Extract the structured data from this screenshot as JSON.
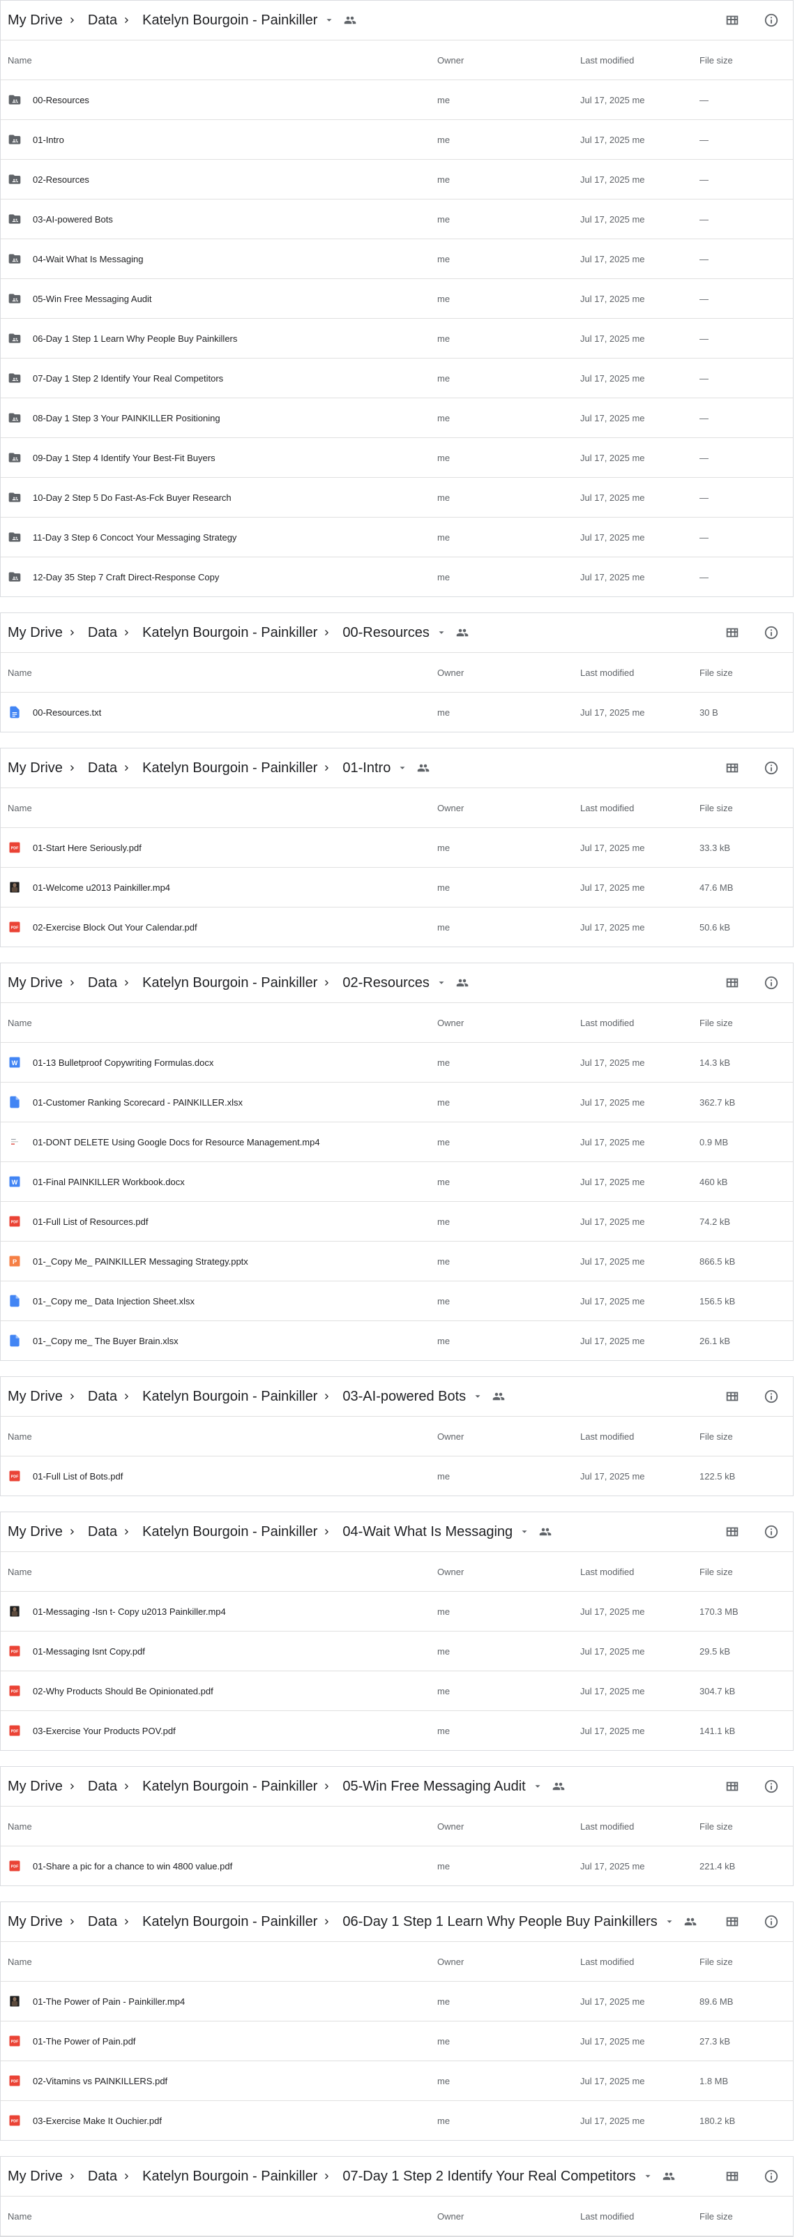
{
  "columns": {
    "name": "Name",
    "owner": "Owner",
    "modified": "Last modified",
    "size": "File size"
  },
  "icons": {
    "chevron": "chevron-right-icon",
    "dropdown": "arrow-drop-down-icon",
    "shared": "people-icon",
    "grid": "grid-view-icon",
    "info": "info-icon",
    "folder": "shared-folder-icon",
    "pdf": "pdf-icon",
    "video": "video-thumbnail-icon",
    "doc": "word-doc-icon",
    "sheet": "blue-file-icon",
    "ppt": "powerpoint-icon",
    "txt": "text-file-icon"
  },
  "colors": {
    "folder": "#5f6368",
    "pdf": "#ea4335",
    "doc": "#4285f4",
    "ppt": "#f57f45",
    "txt": "#4285f4"
  },
  "sections": [
    {
      "crumbs": [
        "My Drive",
        "Data",
        "Katelyn Bourgoin - Painkiller"
      ],
      "rows": [
        {
          "type": "folder",
          "name": "00-Resources",
          "owner": "me",
          "modified": "Jul 17, 2025 me",
          "size": "—"
        },
        {
          "type": "folder",
          "name": "01-Intro",
          "owner": "me",
          "modified": "Jul 17, 2025 me",
          "size": "—"
        },
        {
          "type": "folder",
          "name": "02-Resources",
          "owner": "me",
          "modified": "Jul 17, 2025 me",
          "size": "—"
        },
        {
          "type": "folder",
          "name": "03-AI-powered Bots",
          "owner": "me",
          "modified": "Jul 17, 2025 me",
          "size": "—"
        },
        {
          "type": "folder",
          "name": "04-Wait What Is Messaging",
          "owner": "me",
          "modified": "Jul 17, 2025 me",
          "size": "—"
        },
        {
          "type": "folder",
          "name": "05-Win Free Messaging Audit",
          "owner": "me",
          "modified": "Jul 17, 2025 me",
          "size": "—"
        },
        {
          "type": "folder",
          "name": "06-Day 1 Step 1 Learn Why People Buy Painkillers",
          "owner": "me",
          "modified": "Jul 17, 2025 me",
          "size": "—"
        },
        {
          "type": "folder",
          "name": "07-Day 1 Step 2 Identify Your Real Competitors",
          "owner": "me",
          "modified": "Jul 17, 2025 me",
          "size": "—"
        },
        {
          "type": "folder",
          "name": "08-Day 1 Step 3 Your PAINKILLER Positioning",
          "owner": "me",
          "modified": "Jul 17, 2025 me",
          "size": "—"
        },
        {
          "type": "folder",
          "name": "09-Day 1 Step 4 Identify Your Best-Fit Buyers",
          "owner": "me",
          "modified": "Jul 17, 2025 me",
          "size": "—"
        },
        {
          "type": "folder",
          "name": "10-Day 2 Step 5 Do Fast-As-Fck Buyer Research",
          "owner": "me",
          "modified": "Jul 17, 2025 me",
          "size": "—"
        },
        {
          "type": "folder",
          "name": "11-Day 3 Step 6 Concoct Your Messaging Strategy",
          "owner": "me",
          "modified": "Jul 17, 2025 me",
          "size": "—"
        },
        {
          "type": "folder",
          "name": "12-Day 35 Step 7 Craft Direct-Response Copy",
          "owner": "me",
          "modified": "Jul 17, 2025 me",
          "size": "—"
        }
      ]
    },
    {
      "crumbs": [
        "My Drive",
        "Data",
        "Katelyn Bourgoin - Painkiller",
        "00-Resources"
      ],
      "rows": [
        {
          "type": "txt",
          "name": "00-Resources.txt",
          "owner": "me",
          "modified": "Jul 17, 2025 me",
          "size": "30 B"
        }
      ]
    },
    {
      "crumbs": [
        "My Drive",
        "Data",
        "Katelyn Bourgoin - Painkiller",
        "01-Intro"
      ],
      "rows": [
        {
          "type": "pdf",
          "name": "01-Start Here Seriously.pdf",
          "owner": "me",
          "modified": "Jul 17, 2025 me",
          "size": "33.3 kB"
        },
        {
          "type": "video",
          "name": "01-Welcome u2013 Painkiller.mp4",
          "owner": "me",
          "modified": "Jul 17, 2025 me",
          "size": "47.6 MB"
        },
        {
          "type": "pdf",
          "name": "02-Exercise Block Out Your Calendar.pdf",
          "owner": "me",
          "modified": "Jul 17, 2025 me",
          "size": "50.6 kB"
        }
      ]
    },
    {
      "crumbs": [
        "My Drive",
        "Data",
        "Katelyn Bourgoin - Painkiller",
        "02-Resources"
      ],
      "rows": [
        {
          "type": "doc",
          "name": "01-13 Bulletproof Copywriting Formulas.docx",
          "owner": "me",
          "modified": "Jul 17, 2025 me",
          "size": "14.3 kB"
        },
        {
          "type": "sheet",
          "name": "01-Customer Ranking Scorecard - PAINKILLER.xlsx",
          "owner": "me",
          "modified": "Jul 17, 2025 me",
          "size": "362.7 kB"
        },
        {
          "type": "video2",
          "name": "01-DONT DELETE Using Google Docs for Resource Management.mp4",
          "owner": "me",
          "modified": "Jul 17, 2025 me",
          "size": "0.9 MB"
        },
        {
          "type": "doc",
          "name": "01-Final PAINKILLER Workbook.docx",
          "owner": "me",
          "modified": "Jul 17, 2025 me",
          "size": "460 kB"
        },
        {
          "type": "pdf",
          "name": "01-Full List of Resources.pdf",
          "owner": "me",
          "modified": "Jul 17, 2025 me",
          "size": "74.2 kB"
        },
        {
          "type": "ppt",
          "name": "01-_Copy Me_ PAINKILLER Messaging Strategy.pptx",
          "owner": "me",
          "modified": "Jul 17, 2025 me",
          "size": "866.5 kB"
        },
        {
          "type": "sheet",
          "name": "01-_Copy me_ Data Injection Sheet.xlsx",
          "owner": "me",
          "modified": "Jul 17, 2025 me",
          "size": "156.5 kB"
        },
        {
          "type": "sheet",
          "name": "01-_Copy me_ The Buyer Brain.xlsx",
          "owner": "me",
          "modified": "Jul 17, 2025 me",
          "size": "26.1 kB"
        }
      ]
    },
    {
      "crumbs": [
        "My Drive",
        "Data",
        "Katelyn Bourgoin - Painkiller",
        "03-AI-powered Bots"
      ],
      "rows": [
        {
          "type": "pdf",
          "name": "01-Full List of Bots.pdf",
          "owner": "me",
          "modified": "Jul 17, 2025 me",
          "size": "122.5 kB"
        }
      ]
    },
    {
      "crumbs": [
        "My Drive",
        "Data",
        "Katelyn Bourgoin - Painkiller",
        "04-Wait What Is Messaging"
      ],
      "rows": [
        {
          "type": "video",
          "name": "01-Messaging -Isn t- Copy u2013 Painkiller.mp4",
          "owner": "me",
          "modified": "Jul 17, 2025 me",
          "size": "170.3 MB"
        },
        {
          "type": "pdf",
          "name": "01-Messaging Isnt Copy.pdf",
          "owner": "me",
          "modified": "Jul 17, 2025 me",
          "size": "29.5 kB"
        },
        {
          "type": "pdf",
          "name": "02-Why Products Should Be Opinionated.pdf",
          "owner": "me",
          "modified": "Jul 17, 2025 me",
          "size": "304.7 kB"
        },
        {
          "type": "pdf",
          "name": "03-Exercise Your Products POV.pdf",
          "owner": "me",
          "modified": "Jul 17, 2025 me",
          "size": "141.1 kB"
        }
      ]
    },
    {
      "crumbs": [
        "My Drive",
        "Data",
        "Katelyn Bourgoin - Painkiller",
        "05-Win Free Messaging Audit"
      ],
      "rows": [
        {
          "type": "pdf",
          "name": "01-Share a pic for a chance to win 4800 value.pdf",
          "owner": "me",
          "modified": "Jul 17, 2025 me",
          "size": "221.4 kB"
        }
      ]
    },
    {
      "crumbs": [
        "My Drive",
        "Data",
        "Katelyn Bourgoin - Painkiller",
        "06-Day 1 Step 1 Learn Why People Buy Painkillers"
      ],
      "rows": [
        {
          "type": "video",
          "name": "01-The Power of Pain - Painkiller.mp4",
          "owner": "me",
          "modified": "Jul 17, 2025 me",
          "size": "89.6 MB"
        },
        {
          "type": "pdf",
          "name": "01-The Power of Pain.pdf",
          "owner": "me",
          "modified": "Jul 17, 2025 me",
          "size": "27.3 kB"
        },
        {
          "type": "pdf",
          "name": "02-Vitamins vs PAINKILLERS.pdf",
          "owner": "me",
          "modified": "Jul 17, 2025 me",
          "size": "1.8 MB"
        },
        {
          "type": "pdf",
          "name": "03-Exercise Make It Ouchier.pdf",
          "owner": "me",
          "modified": "Jul 17, 2025 me",
          "size": "180.2 kB"
        }
      ]
    },
    {
      "crumbs": [
        "My Drive",
        "Data",
        "Katelyn Bourgoin - Painkiller",
        "07-Day 1 Step 2 Identify Your Real Competitors"
      ],
      "rows": []
    }
  ]
}
